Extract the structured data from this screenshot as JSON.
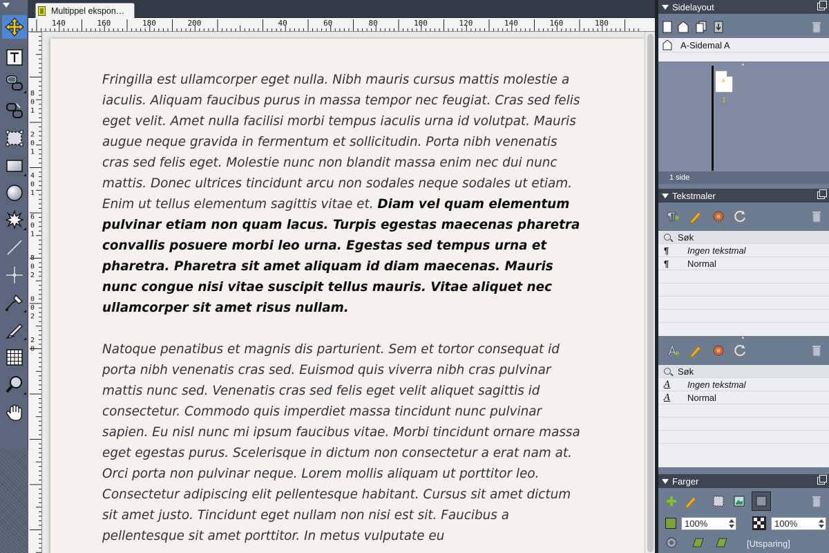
{
  "document": {
    "tab_title": "Multippel ekspon…",
    "ruler_h_labels": [
      "140",
      "160",
      "180",
      "200",
      "",
      "40",
      "60",
      "80",
      "100",
      "120",
      "140",
      "160",
      "180"
    ],
    "ruler_v_labels": [
      "8",
      "0",
      "1",
      "2",
      "0",
      "1",
      "4",
      "0",
      "1",
      "6",
      "0",
      "1",
      "8",
      "0",
      "2",
      "0",
      "0",
      "2",
      "2",
      "0"
    ],
    "paragraph1_italic": "Fringilla est ullamcorper eget nulla. Nibh mauris cursus mattis molestie a iaculis. Aliquam faucibus purus in massa tempor nec feugiat. Cras sed felis eget velit. Amet nulla facilisi morbi tempus iaculis urna id volutpat. Mauris augue neque gravida in fermentum et sollicitudin. Porta nibh venenatis cras sed felis eget. Molestie nunc non blandit massa enim nec dui nunc mattis. Donec ultrices tincidunt arcu non sodales neque sodales ut etiam. Enim ut tellus elementum sagittis vitae et. ",
    "paragraph1_bold": "Diam vel quam elementum pulvinar etiam non quam lacus. Turpis egestas maecenas pharetra convallis posuere morbi leo urna. Egestas sed tempus urna et pharetra. Pharetra sit amet aliquam id diam maecenas. Mauris nunc congue nisi vitae suscipit tellus mauris. Vitae aliquet nec ullamcorper sit amet risus nullam.",
    "paragraph2_italic": "Natoque penatibus et magnis dis parturient. Sem et tortor consequat id porta nibh venenatis cras sed. Euismod quis viverra nibh cras pulvinar mattis nunc sed. Venenatis cras sed felis eget velit aliquet sagittis id consectetur. Commodo quis imperdiet massa tincidunt nunc pulvinar sapien. Eu nisl nunc mi ipsum faucibus vitae. Morbi tincidunt ornare massa eget egestas purus. Scelerisque in dictum non consectetur a erat nam at. Orci porta non pulvinar neque. Lorem mollis aliquam ut porttitor leo. Consectetur adipiscing elit pellentesque habitant. Cursus sit amet dictum sit amet justo. Tincidunt eget nullam non nisi est sit. Faucibus a pellentesque sit amet porttitor. In metus vulputate eu"
  },
  "toolbox": {
    "tools": [
      {
        "name": "select-tool",
        "icon": "move-arrows-icon",
        "active": true
      },
      {
        "name": "text-frame-tool",
        "icon": "text-frame-icon"
      },
      {
        "name": "link-frames-tool",
        "icon": "link-chain-icon"
      },
      {
        "name": "unlink-frames-tool",
        "icon": "unlink-chain-icon"
      },
      {
        "name": "image-frame-tool",
        "icon": "image-frame-icon"
      },
      {
        "name": "rectangle-tool",
        "icon": "rectangle-icon"
      },
      {
        "name": "ellipse-tool",
        "icon": "ellipse-icon"
      },
      {
        "name": "polygon-tool",
        "icon": "starburst-icon"
      },
      {
        "name": "line-tool",
        "icon": "line-icon"
      },
      {
        "name": "orthogonal-line-tool",
        "icon": "crosshair-line-icon"
      },
      {
        "name": "bezier-pen-tool",
        "icon": "pen-nib-icon"
      },
      {
        "name": "freehand-tool",
        "icon": "pencil-icon"
      },
      {
        "name": "table-tool",
        "icon": "table-grid-icon"
      },
      {
        "name": "zoom-tool",
        "icon": "magnifier-icon"
      },
      {
        "name": "hand-tool",
        "icon": "hand-icon"
      }
    ]
  },
  "panels": {
    "page_layout": {
      "title": "Sidelayout",
      "master": "A-Sidemal A",
      "thumb_letter": "A",
      "page_number": "1",
      "page_count": "1 side"
    },
    "text_styles": {
      "title": "Tekstmaler",
      "search_label": "Søk",
      "paragraph_styles": [
        "Ingen tekstmal",
        "Normal"
      ],
      "character_search_label": "Søk",
      "character_styles": [
        "Ingen tekstmal",
        "Normal"
      ]
    },
    "colors": {
      "title": "Farger",
      "fill_opacity": "100%",
      "stroke_opacity": "100%",
      "knockout_label": "[Utsparing]"
    }
  },
  "colors": {
    "accent_green": "#7fc41c",
    "tool_active": "#4c88d6",
    "panel_bg": "#6e7c92"
  }
}
